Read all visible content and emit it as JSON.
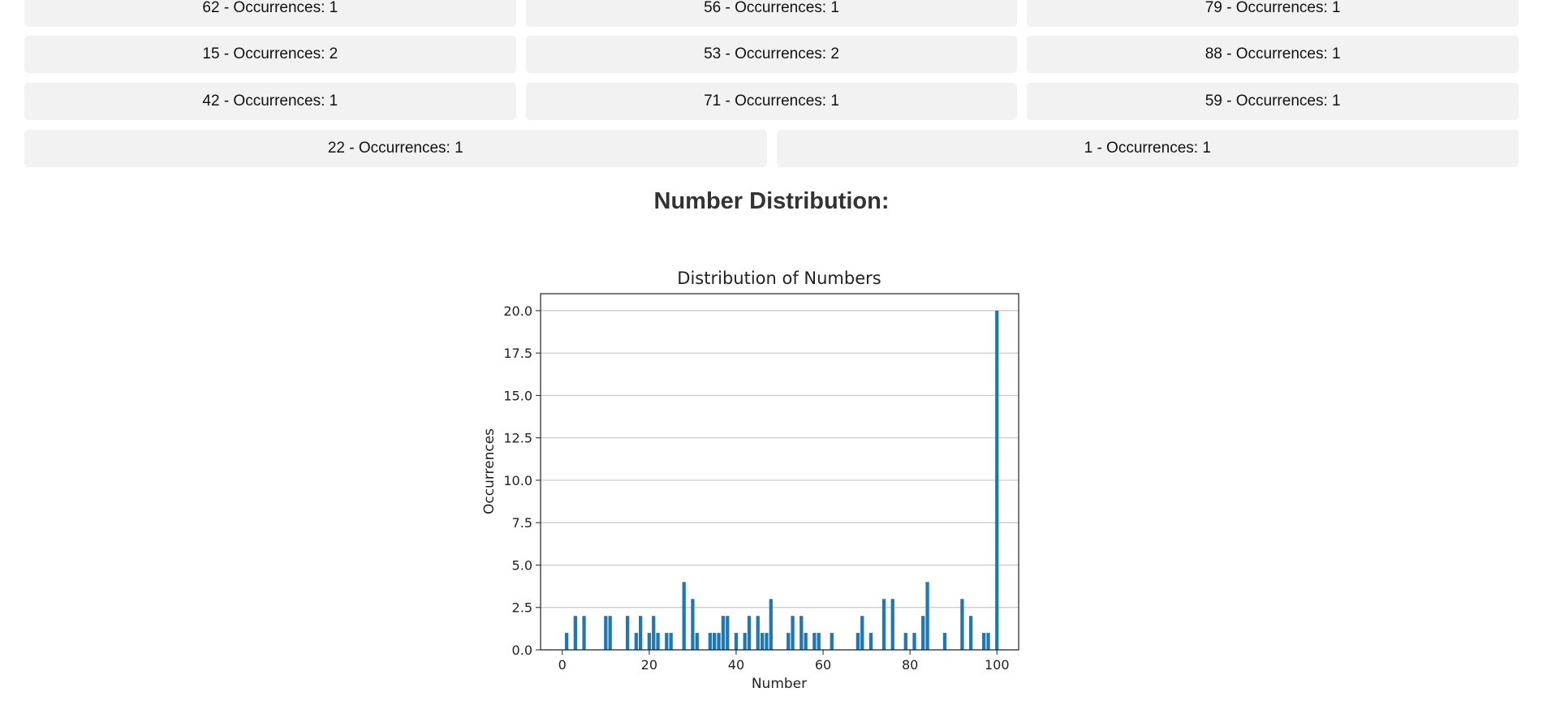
{
  "cards": {
    "row0": [
      "62 - Occurrences: 1",
      "56 - Occurrences: 1",
      "79 - Occurrences: 1"
    ],
    "row1": [
      "15 - Occurrences: 2",
      "53 - Occurrences: 2",
      "88 - Occurrences: 1"
    ],
    "row2": [
      "42 - Occurrences: 1",
      "71 - Occurrences: 1",
      "59 - Occurrences: 1"
    ],
    "row3": [
      "22 - Occurrences: 1",
      "1 - Occurrences: 1"
    ]
  },
  "section_title": "Number Distribution:",
  "chart_data": {
    "type": "bar",
    "title": "Distribution of Numbers",
    "xlabel": "Number",
    "ylabel": "Occurrences",
    "xlim": [
      -5,
      105
    ],
    "ylim": [
      0,
      21
    ],
    "xticks": [
      0,
      20,
      40,
      60,
      80,
      100
    ],
    "yticks": [
      0,
      2.5,
      5,
      7.5,
      10,
      12.5,
      15,
      17.5,
      20
    ],
    "ytick_labels": [
      "0.0",
      "2.5",
      "5.0",
      "7.5",
      "10.0",
      "12.5",
      "15.0",
      "17.5",
      "20.0"
    ],
    "grid": "y",
    "bar_color": "#1f77b4",
    "x": [
      1,
      3,
      5,
      10,
      11,
      15,
      17,
      18,
      20,
      21,
      22,
      24,
      25,
      28,
      30,
      31,
      34,
      35,
      36,
      37,
      38,
      40,
      42,
      43,
      45,
      46,
      47,
      48,
      52,
      53,
      55,
      56,
      58,
      59,
      62,
      68,
      69,
      71,
      74,
      76,
      79,
      81,
      83,
      84,
      88,
      92,
      94,
      97,
      98,
      100
    ],
    "values": [
      1,
      2,
      2,
      2,
      2,
      2,
      1,
      2,
      1,
      2,
      1,
      1,
      1,
      4,
      3,
      1,
      1,
      1,
      1,
      2,
      2,
      1,
      1,
      2,
      2,
      1,
      1,
      3,
      1,
      2,
      2,
      1,
      1,
      1,
      1,
      1,
      2,
      1,
      3,
      3,
      1,
      1,
      2,
      4,
      1,
      3,
      2,
      1,
      1,
      20
    ]
  }
}
